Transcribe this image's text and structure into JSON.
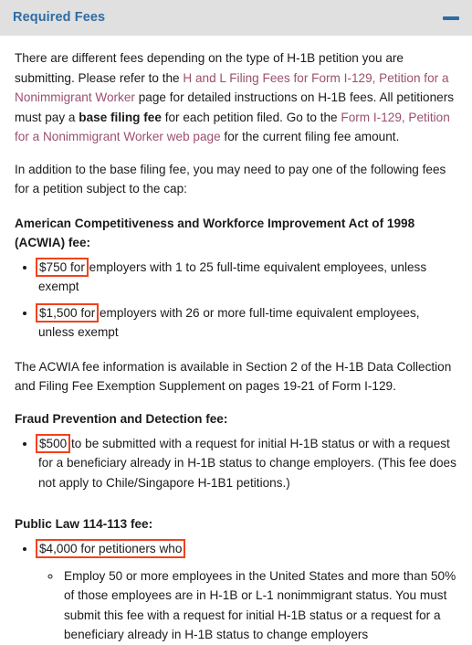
{
  "header": {
    "title": "Required Fees",
    "collapse_icon": "minus-icon",
    "title_color": "#2e6ca4",
    "background_color": "#e0e0e0"
  },
  "annotation": {
    "box_color": "#f4411c",
    "highlights": [
      "$750 for",
      "$1,500 for",
      "$500",
      "$4,000 for petitioners who"
    ]
  },
  "link_color": "#9c4f70",
  "content": {
    "intro": {
      "p1_a": "There are different fees depending on the type of H-1B petition you are submitting. Please refer to the ",
      "link1": "H and L Filing Fees for Form I-129, Petition for a Nonimmigrant Worker",
      "p1_b": " page for detailed instructions on H-1B fees. All petitioners must pay a ",
      "bold1": "base filing fee",
      "p1_c": " for each petition filed. Go to the ",
      "link2": "Form I-129, Petition for a Nonimmigrant Worker web page",
      "p1_d": " for the current filing fee amount."
    },
    "cap_note": "In addition to the base filing fee, you may need to pay one of the following fees for a petition subject to the cap:",
    "acwia": {
      "heading": "American Competitiveness and Workforce Improvement Act of 1998 (ACWIA) fee:",
      "bullet1_highlight": "$750 for",
      "bullet1_rest": " employers with 1 to 25 full-time equivalent employees, unless exempt",
      "bullet2_highlight": "$1,500 for",
      "bullet2_rest": " employers with 26 or more full-time equivalent employees, unless exempt",
      "note": "The ACWIA fee information is available in Section 2 of the H-1B Data Collection and Filing Fee Exemption Supplement on pages 19-21 of Form I-129."
    },
    "fraud": {
      "heading": "Fraud Prevention and Detection fee:",
      "bullet1_highlight": "$500",
      "bullet1_rest": " to be submitted with a request for initial H-1B status or with a request for a beneficiary already in H-1B status to change employers. (This fee does not apply to Chile/Singapore H-1B1 petitions.)"
    },
    "public_law": {
      "heading": "Public Law 114-113 fee:",
      "bullet1_highlight": "$4,000 for petitioners who",
      "subbullet1": "Employ 50 or more employees in the United States and more than 50% of those employees are in H-1B or L-1 nonimmigrant status. You must submit this fee with a request for initial H-1B status or a request for a beneficiary already in H-1B status to change employers"
    }
  }
}
